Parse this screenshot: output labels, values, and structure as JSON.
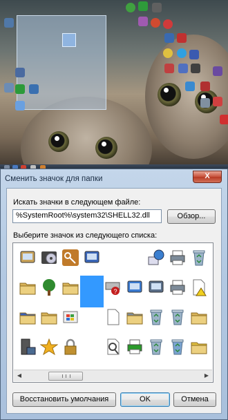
{
  "dialog": {
    "title": "Сменить значок для папки",
    "close_glyph": "X",
    "file_label": "Искать значки в следующем файле:",
    "file_value": "%SystemRoot%\\system32\\SHELL32.dll",
    "browse_label": "Обзор...",
    "list_label": "Выберите значок из следующего списка:",
    "restore_label": "Восстановить умолчания",
    "ok_label": "OK",
    "cancel_label": "Отмена"
  },
  "icons": [
    {
      "name": "window-list-icon",
      "color": "#c9a35a"
    },
    {
      "name": "dvd-drive-icon",
      "color": "#444444"
    },
    {
      "name": "key-icon",
      "color": "#c07a2a"
    },
    {
      "name": "control-panel-icon",
      "color": "#3a66b8"
    },
    {
      "name": "blank-icon",
      "color": ""
    },
    {
      "name": "blank-icon",
      "color": ""
    },
    {
      "name": "network-globe-icon",
      "color": "#3b7fd0"
    },
    {
      "name": "printer-icon",
      "color": "#7d8b99"
    },
    {
      "name": "recycle-bin-icon",
      "color": "#9bb3c8"
    },
    {
      "name": "folder-drive-icon",
      "color": "#d9b45a"
    },
    {
      "name": "tree-icon",
      "color": "#2f8a2f"
    },
    {
      "name": "folder-arrow-icon",
      "color": "#d9b45a"
    },
    {
      "name": "selected-blank-icon",
      "color": "#3399ff"
    },
    {
      "name": "drive-error-icon",
      "color": "#c42020"
    },
    {
      "name": "screen-settings-icon",
      "color": "#3a7ad0"
    },
    {
      "name": "fax-icon",
      "color": "#5a6e88"
    },
    {
      "name": "printer-ok-icon",
      "color": "#7d8b99"
    },
    {
      "name": "document-warning-icon",
      "color": "#e0c030"
    },
    {
      "name": "font-folder-icon",
      "color": "#3a5fb8"
    },
    {
      "name": "folder-monitor-icon",
      "color": "#d9b45a"
    },
    {
      "name": "windows-update-icon",
      "color": "#3aa040"
    },
    {
      "name": "blank-icon",
      "color": ""
    },
    {
      "name": "copy-documents-icon",
      "color": "#bbbbbb"
    },
    {
      "name": "printer-folder-icon",
      "color": "#7d8b99"
    },
    {
      "name": "recycle-bin-full-icon",
      "color": "#9bb3c8"
    },
    {
      "name": "recycle-bin-empty-icon",
      "color": "#9bb3c8"
    },
    {
      "name": "folder-warning-icon",
      "color": "#d9b45a"
    },
    {
      "name": "server-icon",
      "color": "#555555"
    },
    {
      "name": "star-icon",
      "color": "#f0b020"
    },
    {
      "name": "padlock-icon",
      "color": "#c09030"
    },
    {
      "name": "blank-icon",
      "color": ""
    },
    {
      "name": "search-document-icon",
      "color": "#666666"
    },
    {
      "name": "printer-add-icon",
      "color": "#2a9a2a"
    },
    {
      "name": "recycle-bin-small-icon",
      "color": "#9bb3c8"
    },
    {
      "name": "recycle-bin-blue-icon",
      "color": "#7aa3d0"
    },
    {
      "name": "notepad-folder-icon",
      "color": "#e0c040"
    }
  ],
  "scroll": {
    "left_glyph": "◀",
    "right_glyph": "▶"
  }
}
